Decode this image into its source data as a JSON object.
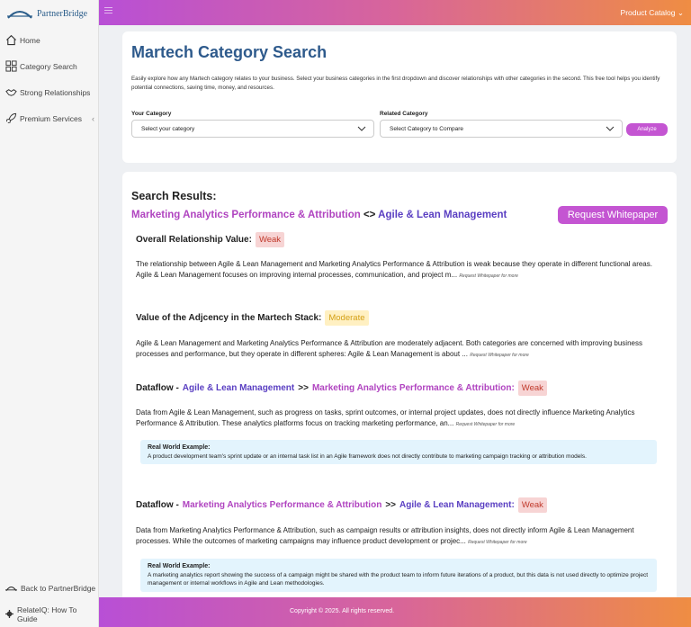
{
  "brand": {
    "name": "PartnerBridge",
    "accent": "#c455d2",
    "title_color": "#2e5a8c"
  },
  "sidebar": {
    "items": [
      {
        "label": "Home",
        "icon": "home-icon"
      },
      {
        "label": "Category Search",
        "icon": "grid-icon"
      },
      {
        "label": "Strong Relationships",
        "icon": "handshake-icon"
      },
      {
        "label": "Premium Services",
        "icon": "rocket-icon"
      }
    ],
    "bottom": [
      {
        "label": "Back to PartnerBridge",
        "icon": "bridge-icon"
      },
      {
        "label": "RelateIQ: How To Guide",
        "icon": "gear-icon"
      }
    ]
  },
  "topbar": {
    "product_catalog": "Product Catalog"
  },
  "search": {
    "title": "Martech Category Search",
    "description": "Easily explore how any Martech category relates to your business. Select your business categories in the first dropdown and discover relationships with other categories in the second. This free tool helps you identify potential connections, saving time, money, and resources.",
    "your_category_label": "Your Category",
    "your_category_value": "Select your category",
    "related_category_label": "Related Category",
    "related_category_value": "Select Category to Compare",
    "analyze_label": "Analyze"
  },
  "results": {
    "heading": "Search Results:",
    "category_a": "Marketing Analytics Performance & Attribution",
    "connector": "<>",
    "category_b": "Agile & Lean Management",
    "whitepaper_button": "Request Whitepaper",
    "request_more": "Request Whitepaper for more",
    "overall": {
      "label": "Overall Relationship Value:",
      "rating": "Weak",
      "text": "The relationship between Agile & Lean Management and Marketing Analytics Performance & Attribution is weak because they operate in different functional areas. Agile & Lean Management focuses on improving internal processes, communication, and project m..."
    },
    "adjacency": {
      "label": "Value of the Adjcency in the Martech Stack:",
      "rating": "Moderate",
      "text": "Agile & Lean Management and Marketing Analytics Performance & Attribution are moderately adjacent. Both categories are concerned with improving business processes and performance, but they operate in different spheres: Agile & Lean Management is about ..."
    },
    "dataflow_prefix": "Dataflow -",
    "dataflow_arrow": ">>",
    "dataflow1": {
      "from": "Agile & Lean Management",
      "to": "Marketing Analytics Performance & Attribution:",
      "rating": "Weak",
      "text": "Data from Agile & Lean Management, such as progress on tasks, sprint outcomes, or internal project updates, does not directly influence Marketing Analytics Performance & Attribution. These analytics platforms focus on tracking marketing performance, an...",
      "example_title": "Real World Example:",
      "example_text": "A product development team's sprint update or an internal task list in an Agile framework does not directly contribute to marketing campaign tracking or attribution models."
    },
    "dataflow2": {
      "from": "Marketing Analytics Performance & Attribution",
      "to": "Agile & Lean Management:",
      "rating": "Weak",
      "text": "Data from Marketing Analytics Performance & Attribution, such as campaign results or attribution insights, does not directly inform Agile & Lean Management processes. While the outcomes of marketing campaigns may influence product development or projec...",
      "example_title": "Real World Example:",
      "example_text": "A marketing analytics report showing the success of a campaign might be shared with the product team to inform future iterations of a product, but this data is not used directly to optimize project management or internal workflows in Agile and Lean methodologies."
    }
  },
  "footer": {
    "copyright": "Copyright © 2025. All rights reserved."
  }
}
